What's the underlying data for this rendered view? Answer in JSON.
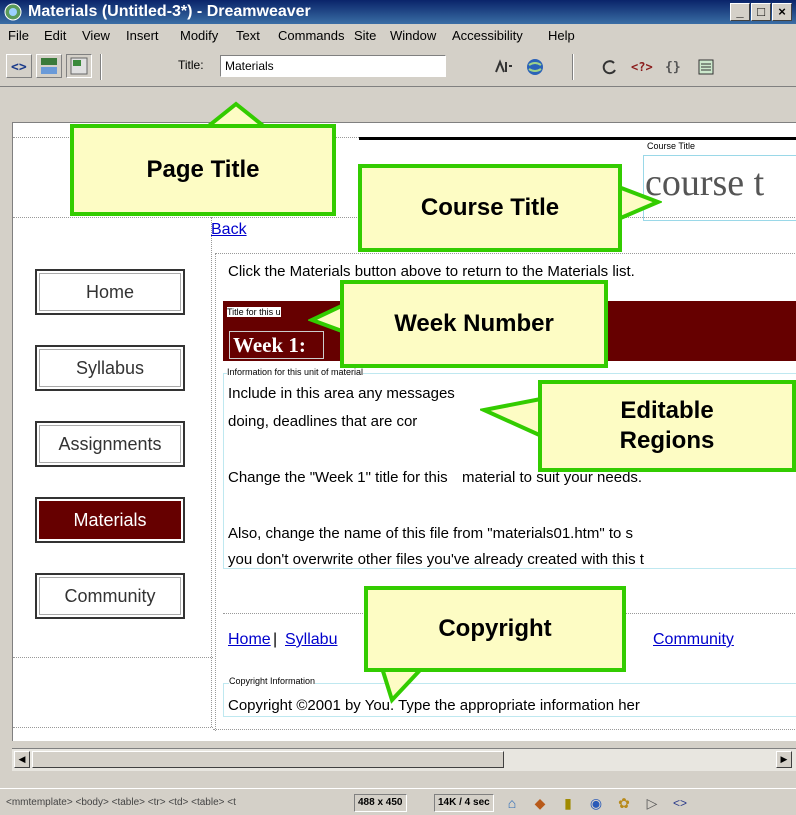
{
  "window": {
    "title": "Materials (Untitled-3*) - Dreamweaver",
    "min_glyph": "_",
    "max_glyph": "□",
    "close_glyph": "×"
  },
  "menu": [
    "File",
    "Edit",
    "View",
    "Insert",
    "Modify",
    "Text",
    "Commands",
    "Site",
    "Window",
    "Accessibility",
    "Help"
  ],
  "toolbar": {
    "title_label": "Title:",
    "title_value": "Materials"
  },
  "page": {
    "course_title_label": "Course Title",
    "course_title_text": "course t",
    "back_link": "Back",
    "instruction": "Click the Materials button above to return to the Materials list.",
    "week_label": "Title for this u",
    "week_title": "Week 1:",
    "info_label": "Information for this unit of material",
    "body_line1": "Include in this area any messages",
    "body_line2": "doing, deadlines that are cor",
    "body_line3a": "Change the \"Week 1\" title for this",
    "body_line3b": "material to suit your needs.",
    "body_line4": "Also, change the name of this file from \"materials01.htm\" to s",
    "body_line5": "you don't overwrite other files you've already created with this t",
    "footer_links": {
      "home": "Home",
      "syllabus": "Syllabu",
      "sep": "|",
      "community": "Community"
    },
    "copyright_label": "Copyright Information",
    "copyright_text": "Copyright ©2001 by You. Type the appropriate information her"
  },
  "nav": [
    {
      "label": "Home",
      "active": false
    },
    {
      "label": "Syllabus",
      "active": false
    },
    {
      "label": "Assignments",
      "active": false
    },
    {
      "label": "Materials",
      "active": true
    },
    {
      "label": "Community",
      "active": false
    }
  ],
  "callouts": {
    "page_title": "Page Title",
    "course_title": "Course Title",
    "week_number": "Week Number",
    "editable_line1": "Editable",
    "editable_line2": "Regions",
    "copyright": "Copyright"
  },
  "status": {
    "tag_selector": "<mmtemplate> <body> <table> <tr> <td> <table> <t",
    "window_size": "488 x 450",
    "download": "14K / 4 sec"
  },
  "colors": {
    "accent": "#660000",
    "callout_border": "#33cc00",
    "callout_fill": "#fdfcc4",
    "titlebar": "#0a246a"
  }
}
